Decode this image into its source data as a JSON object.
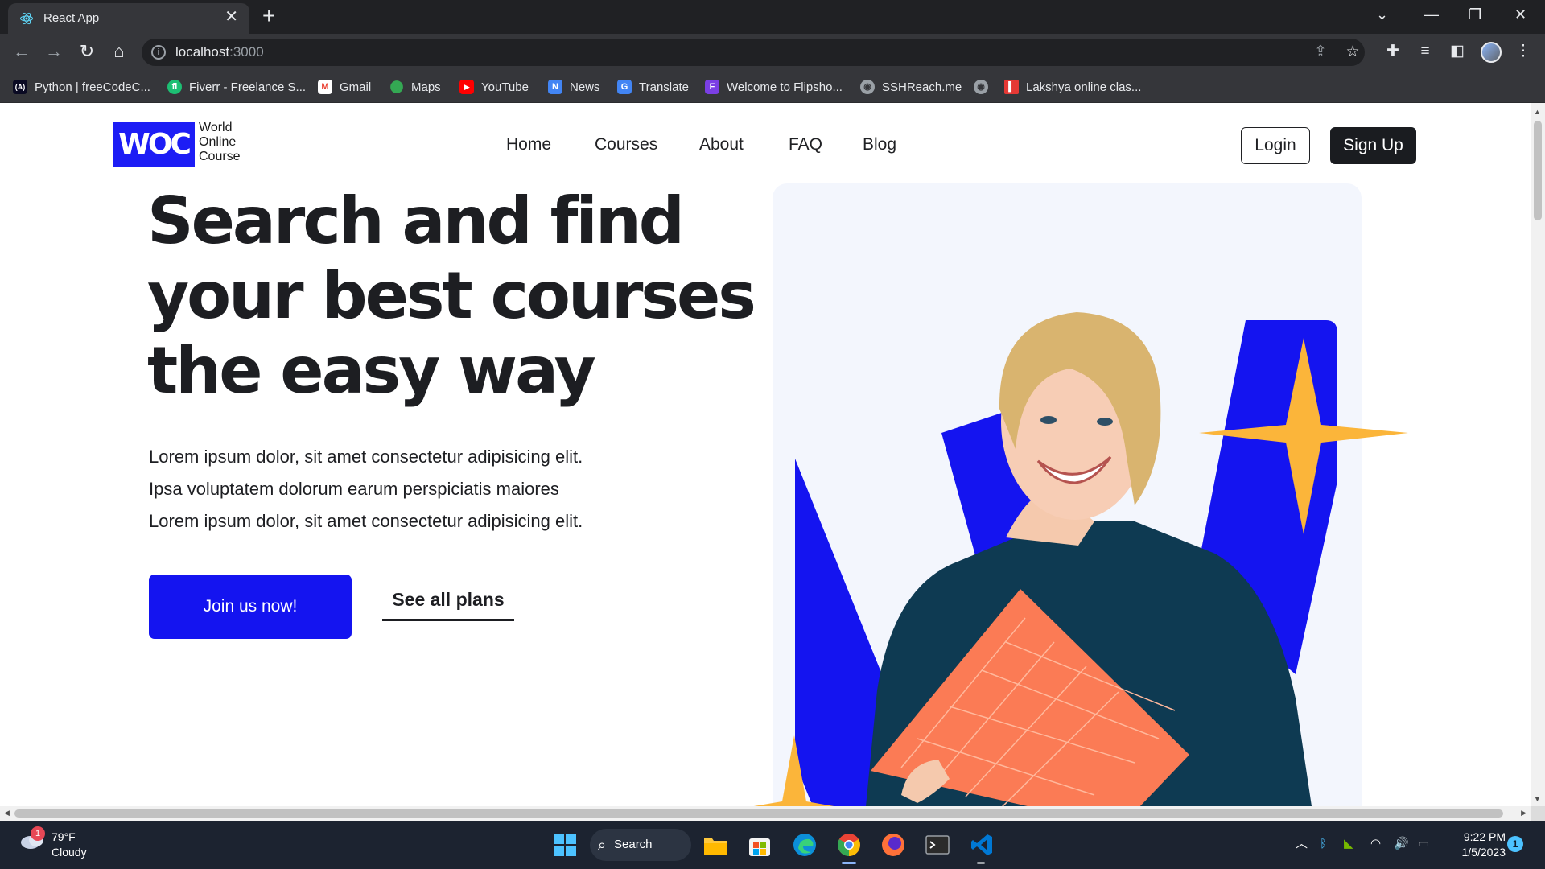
{
  "browser": {
    "tab_title": "React App",
    "tab_close": "✕",
    "new_tab": "+",
    "url_host": "localhost",
    "url_port": ":3000",
    "bookmarks": [
      {
        "label": "Python | freeCodeC...",
        "color": "#0a0a23",
        "glyph": "(A)"
      },
      {
        "label": "Fiverr - Freelance S...",
        "color": "#1dbf73",
        "glyph": "fi"
      },
      {
        "label": "Gmail",
        "color": "#ea4335",
        "glyph": "M"
      },
      {
        "label": "Maps",
        "color": "#34a853",
        "glyph": "●"
      },
      {
        "label": "YouTube",
        "color": "#ff0000",
        "glyph": "▶"
      },
      {
        "label": "News",
        "color": "#4285f4",
        "glyph": "N"
      },
      {
        "label": "Translate",
        "color": "#4285f4",
        "glyph": "G"
      },
      {
        "label": "Welcome to Flipsho...",
        "color": "#7b3fe4",
        "glyph": "F"
      },
      {
        "label": "SSHReach.me",
        "color": "#5f6368",
        "glyph": "◉"
      },
      {
        "label": "",
        "color": "#5f6368",
        "glyph": "◉"
      },
      {
        "label": "Lakshya online clas...",
        "color": "#e53935",
        "glyph": "▌"
      }
    ]
  },
  "site": {
    "logo_mark": "WOC",
    "logo_text": [
      "World",
      "Online",
      "Course"
    ],
    "nav": [
      "Home",
      "Courses",
      "About",
      "FAQ",
      "Blog"
    ],
    "login": "Login",
    "signup": "Sign Up",
    "hero_title": [
      "Search and find",
      "your best courses",
      "the easy way"
    ],
    "hero_desc": [
      "Lorem ipsum dolor, sit amet consectetur adipisicing elit.",
      "Ipsa voluptatem dolorum earum perspiciatis maiores",
      "Lorem ipsum dolor, sit amet consectetur adipisicing elit."
    ],
    "cta_primary": "Join us now!",
    "cta_secondary": "See all plans",
    "colors": {
      "brand_blue": "#1414f0",
      "star_yellow": "#fbb53a",
      "dark": "#1d1e22"
    }
  },
  "taskbar": {
    "weather_temp": "79°F",
    "weather_desc": "Cloudy",
    "weather_badge": "1",
    "search_label": "Search",
    "time": "9:22 PM",
    "date": "1/5/2023",
    "notifications": "1"
  }
}
